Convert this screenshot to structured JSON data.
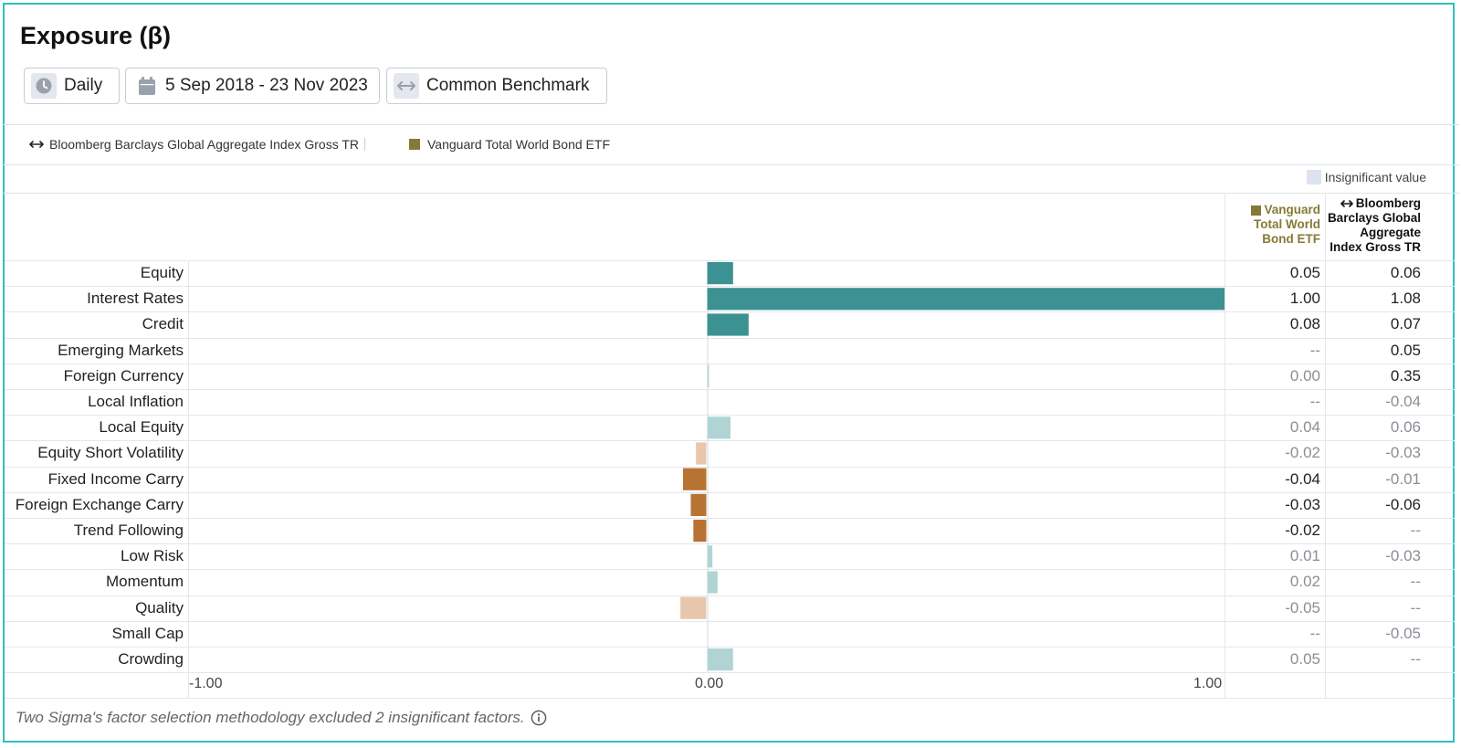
{
  "title": "Exposure (β)",
  "controls": {
    "frequency": {
      "label": "Daily",
      "icon": "clock-icon"
    },
    "date_range": {
      "label": "5 Sep 2018 - 23 Nov 2023",
      "icon": "calendar-icon"
    },
    "benchmark": {
      "label": "Common Benchmark",
      "icon": "arrows-horizontal-icon"
    }
  },
  "legend": {
    "benchmark": {
      "label": "Bloomberg Barclays Global Aggregate Index Gross TR",
      "icon": "arrows-horizontal-icon"
    },
    "fund": {
      "label": "Vanguard Total World Bond ETF",
      "color": "#857a35"
    }
  },
  "insignificant_label": "Insignificant value",
  "columns": {
    "fund": {
      "lines": [
        "Vanguard",
        "Total World",
        "Bond ETF"
      ],
      "color": "#857a35"
    },
    "benchmark": {
      "lines": [
        "Bloomberg",
        "Barclays Global",
        "Aggregate",
        "Index Gross TR"
      ],
      "icon": "arrows-horizontal-icon"
    }
  },
  "colors": {
    "positive": "#3c9192",
    "positive_insignificant": "#b0d4d4",
    "negative": "#b87333",
    "negative_insignificant": "#e6c7ad",
    "insignificant_swatch": "#dde3ec",
    "border": "#2fbfc0"
  },
  "chart_data": {
    "type": "bar",
    "orientation": "horizontal",
    "xlim": [
      -1.0,
      1.0
    ],
    "x_ticks": [
      "-1.00",
      "0.00",
      "1.00"
    ],
    "categories": [
      "Equity",
      "Interest Rates",
      "Credit",
      "Emerging Markets",
      "Foreign Currency",
      "Local Inflation",
      "Local Equity",
      "Equity Short Volatility",
      "Fixed Income Carry",
      "Foreign Exchange Carry",
      "Trend Following",
      "Low Risk",
      "Momentum",
      "Quality",
      "Small Cap",
      "Crowding"
    ],
    "series": [
      {
        "name": "Vanguard Total World Bond ETF",
        "values": [
          0.05,
          1.0,
          0.08,
          null,
          0.002,
          null,
          0.045,
          -0.02,
          -0.045,
          -0.03,
          -0.025,
          0.01,
          0.02,
          -0.05,
          null,
          0.05
        ],
        "significant": [
          true,
          true,
          true,
          null,
          false,
          null,
          false,
          false,
          true,
          true,
          true,
          false,
          false,
          false,
          null,
          false
        ],
        "labels": [
          "0.05",
          "1.00",
          "0.08",
          "--",
          "0.00",
          "--",
          "0.04",
          "-0.02",
          "-0.04",
          "-0.03",
          "-0.02",
          "0.01",
          "0.02",
          "-0.05",
          "--",
          "0.05"
        ]
      },
      {
        "name": "Bloomberg Barclays Global Aggregate Index Gross TR",
        "values": [
          0.06,
          1.08,
          0.07,
          0.05,
          0.35,
          -0.04,
          0.06,
          -0.03,
          -0.01,
          -0.06,
          null,
          -0.03,
          null,
          null,
          -0.05,
          null
        ],
        "significant": [
          true,
          true,
          true,
          true,
          true,
          false,
          false,
          false,
          false,
          true,
          null,
          false,
          null,
          null,
          false,
          null
        ],
        "labels": [
          "0.06",
          "1.08",
          "0.07",
          "0.05",
          "0.35",
          "-0.04",
          "0.06",
          "-0.03",
          "-0.01",
          "-0.06",
          "--",
          "-0.03",
          "--",
          "--",
          "-0.05",
          "--"
        ]
      }
    ]
  },
  "footnote": "Two Sigma's factor selection methodology excluded 2 insignificant factors."
}
